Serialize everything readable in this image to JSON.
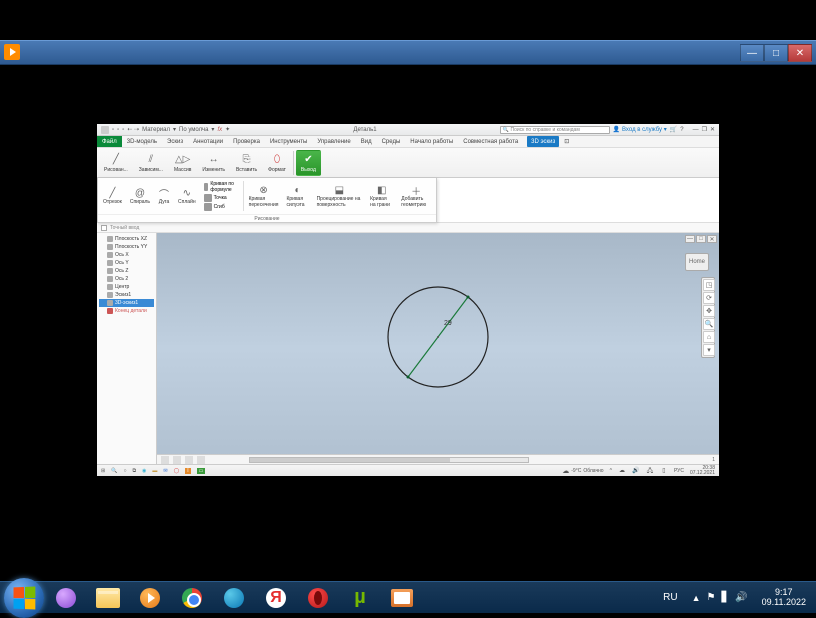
{
  "outer_taskbar": {
    "lang": "RU",
    "time": "9:17",
    "date": "09.11.2022",
    "yandex_letter": "Я",
    "utorrent_letter": "µ"
  },
  "inner_app": {
    "qat": {
      "title": "Деталь1",
      "default_label": "По умолча",
      "material_label": "Материал",
      "fx_label": "fx",
      "search_placeholder": "Поиск по справке и командам",
      "signin": "Вход в службу"
    },
    "menu": {
      "file": "Файл",
      "items": [
        "3D-модель",
        "Эскиз",
        "Аннотации",
        "Проверка",
        "Инструменты",
        "Управление",
        "Вид",
        "Среды",
        "Начало работы",
        "Совместная работа"
      ],
      "active_tab": "3D эскиз",
      "extra_icon": "⊡"
    },
    "ribbon": {
      "draw": "Рисован...",
      "constrain": "Зависим...",
      "pattern": "Массив",
      "modify": "Изменить",
      "insert": "Вставить",
      "format": "Формат",
      "finish": "Выход"
    },
    "subribbon": {
      "segment": "Отрезок",
      "spiral": "Спираль",
      "arc": "Дуга",
      "spline": "Сплайн",
      "formula_curve": "Кривая по формуле",
      "point": "Точка",
      "bend": "Сгиб",
      "intersect_curve": "Кривая пересечения",
      "silhouette": "Кривая силуэта",
      "project_surface": "Проецирование на поверхность",
      "face_curve": "Кривая на грани",
      "add_geom": "Добавить геометрию",
      "group_label": "Рисование"
    },
    "precise_input": "Точный ввод",
    "browser": {
      "items": [
        {
          "label": "Плоскость XZ"
        },
        {
          "label": "Плоскость YY"
        },
        {
          "label": "Ось X"
        },
        {
          "label": "Ось Y"
        },
        {
          "label": "Ось Z"
        },
        {
          "label": "Ось 2"
        },
        {
          "label": "Центр"
        },
        {
          "label": "Эскиз1"
        },
        {
          "label": "3D-эскиз1",
          "selected": true
        },
        {
          "label": "Конец детали",
          "end": true
        }
      ]
    },
    "viewport": {
      "home": "Home",
      "dimension": "29",
      "footer_count": "1"
    },
    "status": {
      "temp": "-9°C",
      "weather": "Облачно",
      "lang": "РУС",
      "time": "20:38",
      "date": "07.12.2021"
    }
  }
}
